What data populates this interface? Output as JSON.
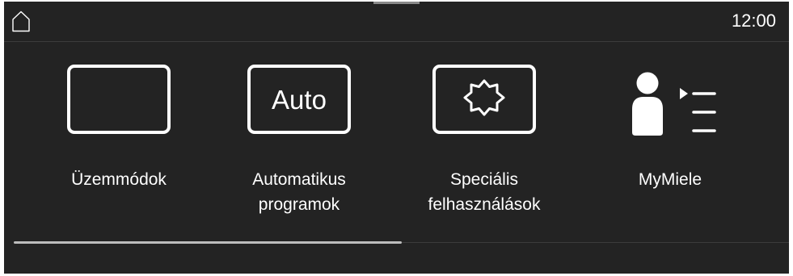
{
  "header": {
    "home_icon": "home-icon",
    "time": "12:00"
  },
  "tiles": [
    {
      "icon": "empty-screen-icon",
      "lines": [
        "Üzemmódok"
      ]
    },
    {
      "icon": "auto-icon",
      "icon_text": "Auto",
      "lines": [
        "Automatikus",
        "programok"
      ]
    },
    {
      "icon": "starburst-icon",
      "lines": [
        "Speciális",
        "felhasználások"
      ]
    },
    {
      "icon": "user-list-icon",
      "lines": [
        "MyMiele"
      ]
    }
  ],
  "scroll": {
    "visible_fraction": 0.5,
    "position_fraction": 0.0
  }
}
